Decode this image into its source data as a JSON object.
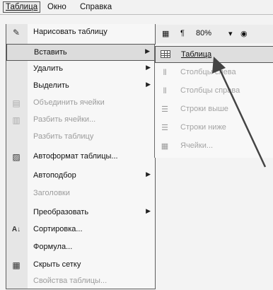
{
  "menubar": [
    {
      "label": "Таблица",
      "active": true
    },
    {
      "label": "Окно",
      "active": false
    },
    {
      "label": "Справка",
      "active": false
    }
  ],
  "toolbar": {
    "zoom": "80%",
    "pilcrow": "¶"
  },
  "menu": [
    {
      "label": "Нарисовать таблицу",
      "icon": "pencil-icon",
      "disabled": false,
      "submenu": false
    },
    {
      "label": "Вставить",
      "icon": "",
      "disabled": false,
      "submenu": true,
      "highlighted": true
    },
    {
      "label": "Удалить",
      "icon": "",
      "disabled": false,
      "submenu": true
    },
    {
      "label": "Выделить",
      "icon": "",
      "disabled": false,
      "submenu": true
    },
    {
      "label": "Объединить ячейки",
      "icon": "merge-cells-icon",
      "disabled": true,
      "submenu": false
    },
    {
      "label": "Разбить ячейки...",
      "icon": "split-cells-icon",
      "disabled": true,
      "submenu": false
    },
    {
      "label": "Разбить таблицу",
      "icon": "",
      "disabled": true,
      "submenu": false
    },
    {
      "label": "Автоформат таблицы...",
      "icon": "autoformat-icon",
      "disabled": false,
      "submenu": false
    },
    {
      "label": "Автоподбор",
      "icon": "",
      "disabled": false,
      "submenu": true
    },
    {
      "label": "Заголовки",
      "icon": "",
      "disabled": true,
      "submenu": false
    },
    {
      "label": "Преобразовать",
      "icon": "",
      "disabled": false,
      "submenu": true
    },
    {
      "label": "Сортировка...",
      "icon": "sort-icon",
      "disabled": false,
      "submenu": false
    },
    {
      "label": "Формула...",
      "icon": "",
      "disabled": false,
      "submenu": false
    },
    {
      "label": "Скрыть сетку",
      "icon": "grid-icon",
      "disabled": false,
      "submenu": false
    },
    {
      "label": "Свойства таблицы...",
      "icon": "",
      "disabled": true,
      "submenu": false
    }
  ],
  "submenu": [
    {
      "label": "Таблица",
      "icon": "table-icon",
      "disabled": false,
      "highlighted": true
    },
    {
      "label": "Столбцы слева",
      "icon": "insert-columns-left-icon",
      "disabled": true
    },
    {
      "label": "Столбцы справа",
      "icon": "insert-columns-right-icon",
      "disabled": true
    },
    {
      "label": "Строки выше",
      "icon": "insert-rows-above-icon",
      "disabled": true
    },
    {
      "label": "Строки ниже",
      "icon": "insert-rows-below-icon",
      "disabled": true
    },
    {
      "label": "Ячейки...",
      "icon": "insert-cells-icon",
      "disabled": true
    }
  ]
}
